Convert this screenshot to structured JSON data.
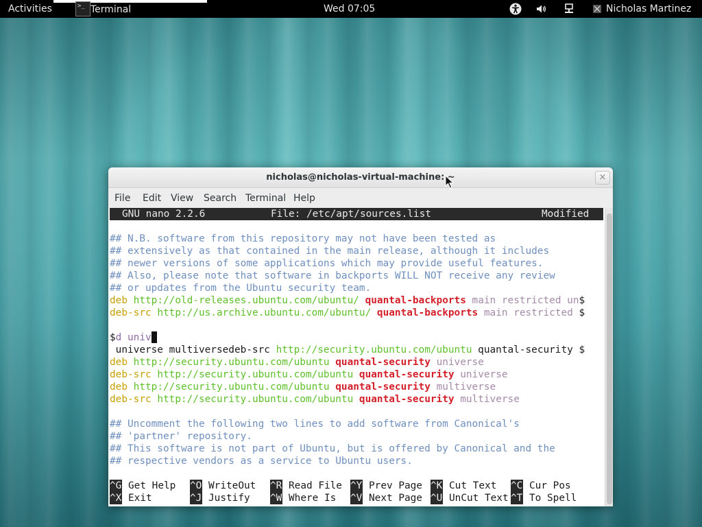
{
  "topbar": {
    "activities": "Activities",
    "app_icon_glyph": ">_",
    "app_name": "Terminal",
    "clock": "Wed 07:05",
    "user": "Nicholas Martinez",
    "icons": [
      "accessibility-icon",
      "volume-icon",
      "network-icon",
      "user-status-icon"
    ]
  },
  "window": {
    "title": "nicholas@nicholas-virtual-machine: ~",
    "close_glyph": "×",
    "menu": [
      "File",
      "Edit",
      "View",
      "Search",
      "Terminal",
      "Help"
    ]
  },
  "nano": {
    "version": "GNU nano 2.2.6",
    "file": "File: /etc/apt/sources.list",
    "status": "Modified"
  },
  "lines": [
    [],
    [
      [
        "## N.B. software from this repository may not have been tested as",
        "c"
      ]
    ],
    [
      [
        "## extensively as that contained in the main release, although it includes",
        "c"
      ]
    ],
    [
      [
        "## newer versions of some applications which may provide useful features.",
        "c"
      ]
    ],
    [
      [
        "## Also, please note that software in backports WILL NOT receive any review",
        "c"
      ]
    ],
    [
      [
        "## or updates from the Ubuntu security team.",
        "c"
      ]
    ],
    [
      [
        "deb",
        "d"
      ],
      [
        " ",
        "t"
      ],
      [
        "http://old-releases.ubuntu.com/ubuntu/",
        "u"
      ],
      [
        " ",
        "t"
      ],
      [
        "quantal-backports",
        "s"
      ],
      [
        " ",
        "t"
      ],
      [
        "main restricted un",
        "m"
      ],
      [
        "$",
        "t"
      ]
    ],
    [
      [
        "deb-src",
        "d"
      ],
      [
        " ",
        "t"
      ],
      [
        "http://us.archive.ubuntu.com/ubuntu/",
        "u"
      ],
      [
        " ",
        "t"
      ],
      [
        "quantal-backports",
        "s"
      ],
      [
        " ",
        "t"
      ],
      [
        "main restricted ",
        "m"
      ],
      [
        "$",
        "t"
      ]
    ],
    [],
    [
      [
        "$",
        "t"
      ],
      [
        "d univ",
        "p"
      ],
      [
        "",
        "cursor"
      ]
    ],
    [
      [
        " universe multiversedeb-src ",
        "t"
      ],
      [
        "http://security.ubuntu.com/ubuntu",
        "u"
      ],
      [
        " quantal-security $",
        "t"
      ]
    ],
    [
      [
        "deb",
        "d"
      ],
      [
        " ",
        "t"
      ],
      [
        "http://security.ubuntu.com/ubuntu",
        "u"
      ],
      [
        " ",
        "t"
      ],
      [
        "quantal-security",
        "s"
      ],
      [
        " ",
        "t"
      ],
      [
        "universe",
        "m"
      ]
    ],
    [
      [
        "deb-src",
        "d"
      ],
      [
        " ",
        "t"
      ],
      [
        "http://security.ubuntu.com/ubuntu",
        "u"
      ],
      [
        " ",
        "t"
      ],
      [
        "quantal-security",
        "s"
      ],
      [
        " ",
        "t"
      ],
      [
        "universe",
        "m"
      ]
    ],
    [
      [
        "deb",
        "d"
      ],
      [
        " ",
        "t"
      ],
      [
        "http://security.ubuntu.com/ubuntu",
        "u"
      ],
      [
        " ",
        "t"
      ],
      [
        "quantal-security",
        "s"
      ],
      [
        " ",
        "t"
      ],
      [
        "multiverse",
        "m"
      ]
    ],
    [
      [
        "deb-src",
        "d"
      ],
      [
        " ",
        "t"
      ],
      [
        "http://security.ubuntu.com/ubuntu",
        "u"
      ],
      [
        " ",
        "t"
      ],
      [
        "quantal-security",
        "s"
      ],
      [
        " ",
        "t"
      ],
      [
        "multiverse",
        "m"
      ]
    ],
    [],
    [
      [
        "## Uncomment the following two lines to add software from Canonical's",
        "c"
      ]
    ],
    [
      [
        "## 'partner' repository.",
        "c"
      ]
    ],
    [
      [
        "## This software is not part of Ubuntu, but is offered by Canonical and the",
        "c"
      ]
    ],
    [
      [
        "## respective vendors as a service to Ubuntu users.",
        "c"
      ]
    ]
  ],
  "shortcuts": [
    [
      {
        "key": "^G",
        "label": "Get Help"
      },
      {
        "key": "^O",
        "label": "WriteOut"
      },
      {
        "key": "^R",
        "label": "Read File"
      },
      {
        "key": "^Y",
        "label": "Prev Page"
      },
      {
        "key": "^K",
        "label": "Cut Text"
      },
      {
        "key": "^C",
        "label": "Cur Pos"
      }
    ],
    [
      {
        "key": "^X",
        "label": "Exit"
      },
      {
        "key": "^J",
        "label": "Justify"
      },
      {
        "key": "^W",
        "label": "Where Is"
      },
      {
        "key": "^V",
        "label": "Next Page"
      },
      {
        "key": "^U",
        "label": "UnCut Text"
      },
      {
        "key": "^T",
        "label": "To Spell"
      }
    ]
  ]
}
